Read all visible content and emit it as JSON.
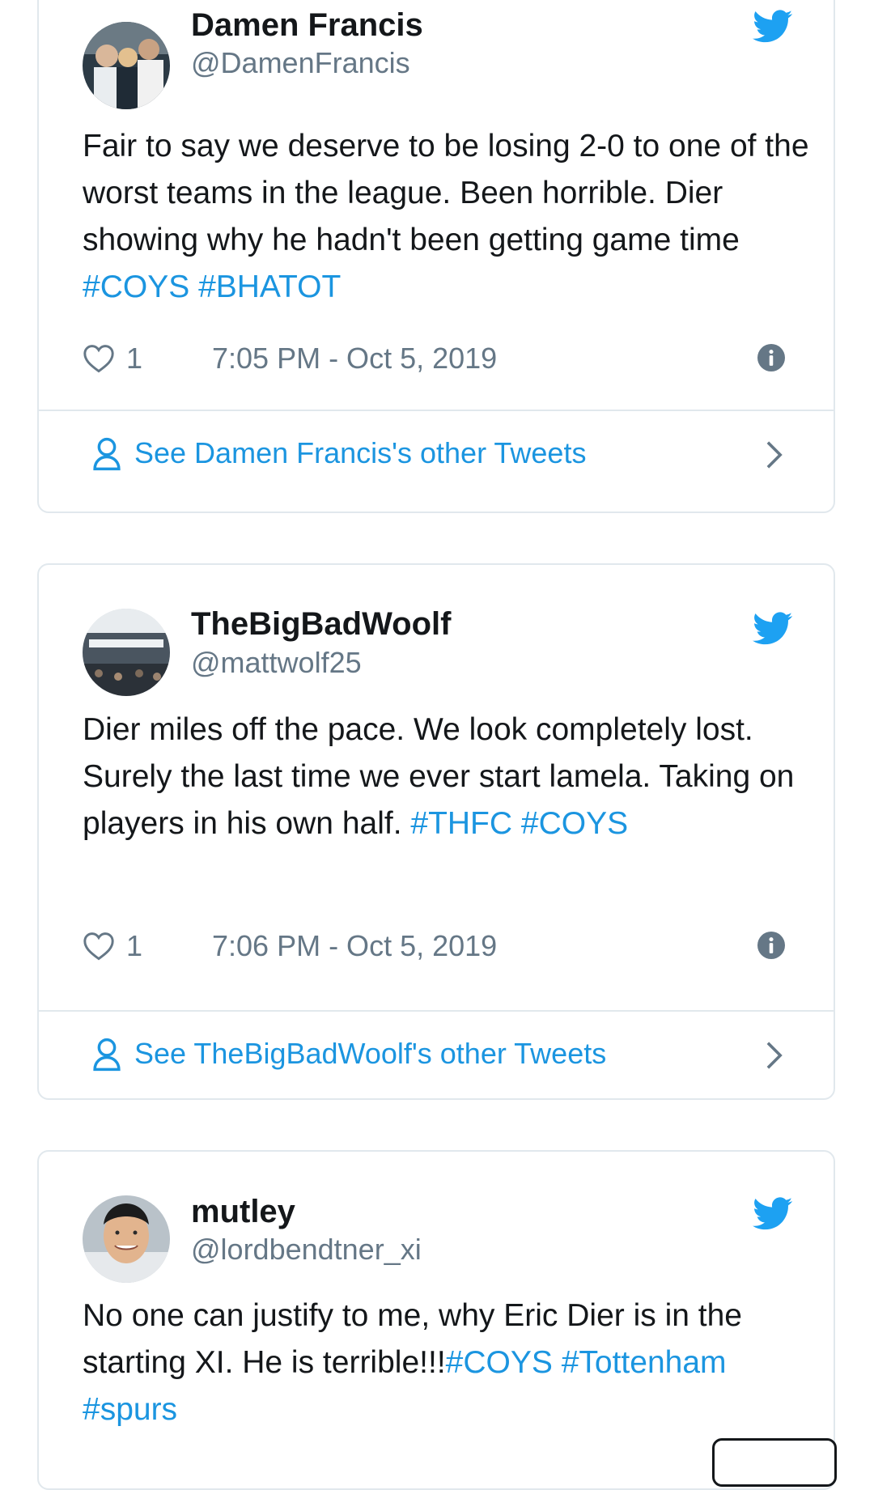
{
  "tweets": [
    {
      "name": "Damen Francis",
      "handle": "@DamenFrancis",
      "text": [
        {
          "t": "Fair to say we deserve to be losing 2-0 to one of the worst teams in the league. Been horrible. Dier showing why he hadn't been getting game time "
        },
        {
          "t": "#COYS",
          "tag": true
        },
        {
          "t": " "
        },
        {
          "t": "#BHATOT",
          "tag": true
        }
      ],
      "likes": "1",
      "timestamp": "7:05 PM - Oct 5, 2019",
      "see_more": "See Damen Francis's other Tweets"
    },
    {
      "name": "TheBigBadWoolf",
      "handle": "@mattwolf25",
      "text": [
        {
          "t": "Dier miles off the pace. We look completely lost. Surely the last time we ever start lamela. Taking on players in his own half. "
        },
        {
          "t": "#THFC",
          "tag": true
        },
        {
          "t": " "
        },
        {
          "t": "#COYS",
          "tag": true
        }
      ],
      "likes": "1",
      "timestamp": "7:06 PM - Oct 5, 2019",
      "see_more": "See TheBigBadWoolf's other Tweets"
    },
    {
      "name": "mutley",
      "handle": "@lordbendtner_xi",
      "text": [
        {
          "t": "No one can justify to me, why Eric Dier is in the starting XI. He is terrible!!!"
        },
        {
          "t": "#COYS",
          "tag": true
        },
        {
          "t": " "
        },
        {
          "t": "#Tottenham",
          "tag": true
        },
        {
          "t": " "
        },
        {
          "t": "#spurs",
          "tag": true
        }
      ]
    }
  ],
  "colors": {
    "twitter_blue": "#1da1f2",
    "link_blue": "#1b95e0",
    "text_primary": "#14171a",
    "text_secondary": "#657786",
    "border": "#e1e8ed"
  },
  "icons": [
    "twitter-bird-icon",
    "heart-icon",
    "info-icon",
    "person-icon",
    "chevron-right-icon"
  ]
}
